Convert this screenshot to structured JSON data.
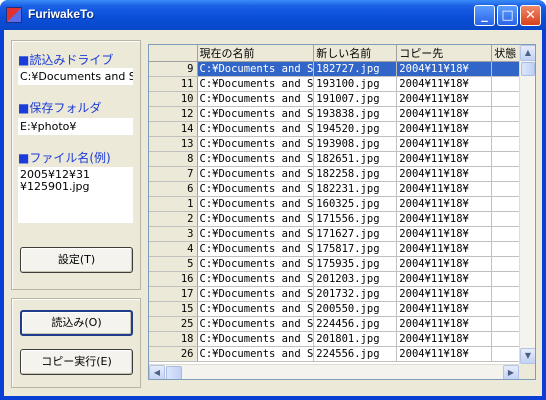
{
  "window": {
    "title": "FuriwakeTo"
  },
  "titlebar": {
    "min_glyph": "_",
    "max_glyph": "□",
    "close_glyph": "✕"
  },
  "panel": {
    "read_drive_label": "■読込みドライブ",
    "read_drive_value": "C:¥Documents and Se",
    "save_folder_label": "■保存フォルダ",
    "save_folder_value": "E:¥photo¥",
    "filename_label": "■ファイル名(例)",
    "filename_example_line1": "2005¥12¥31",
    "filename_example_line2": "¥125901.jpg",
    "settings_button": "設定(T)",
    "load_button": "読込み(O)",
    "copy_button": "コピー実行(E)"
  },
  "grid": {
    "columns": [
      "",
      "現在の名前",
      "新しい名前",
      "コピー先",
      "状態"
    ],
    "selected_row_index": 0,
    "rows": [
      [
        "9",
        "C:¥Documents and S",
        "182727.jpg",
        "2004¥11¥18¥",
        ""
      ],
      [
        "11",
        "C:¥Documents and S",
        "193100.jpg",
        "2004¥11¥18¥",
        ""
      ],
      [
        "10",
        "C:¥Documents and S",
        "191007.jpg",
        "2004¥11¥18¥",
        ""
      ],
      [
        "12",
        "C:¥Documents and S",
        "193838.jpg",
        "2004¥11¥18¥",
        ""
      ],
      [
        "14",
        "C:¥Documents and S",
        "194520.jpg",
        "2004¥11¥18¥",
        ""
      ],
      [
        "13",
        "C:¥Documents and S",
        "193908.jpg",
        "2004¥11¥18¥",
        ""
      ],
      [
        "8",
        "C:¥Documents and S",
        "182651.jpg",
        "2004¥11¥18¥",
        ""
      ],
      [
        "7",
        "C:¥Documents and S",
        "182258.jpg",
        "2004¥11¥18¥",
        ""
      ],
      [
        "6",
        "C:¥Documents and S",
        "182231.jpg",
        "2004¥11¥18¥",
        ""
      ],
      [
        "1",
        "C:¥Documents and S",
        "160325.jpg",
        "2004¥11¥18¥",
        ""
      ],
      [
        "2",
        "C:¥Documents and S",
        "171556.jpg",
        "2004¥11¥18¥",
        ""
      ],
      [
        "3",
        "C:¥Documents and S",
        "171627.jpg",
        "2004¥11¥18¥",
        ""
      ],
      [
        "4",
        "C:¥Documents and S",
        "175817.jpg",
        "2004¥11¥18¥",
        ""
      ],
      [
        "5",
        "C:¥Documents and S",
        "175935.jpg",
        "2004¥11¥18¥",
        ""
      ],
      [
        "16",
        "C:¥Documents and S",
        "201203.jpg",
        "2004¥11¥18¥",
        ""
      ],
      [
        "17",
        "C:¥Documents and S",
        "201732.jpg",
        "2004¥11¥18¥",
        ""
      ],
      [
        "15",
        "C:¥Documents and S",
        "200550.jpg",
        "2004¥11¥18¥",
        ""
      ],
      [
        "25",
        "C:¥Documents and S",
        "224456.jpg",
        "2004¥11¥18¥",
        ""
      ],
      [
        "18",
        "C:¥Documents and S",
        "201801.jpg",
        "2004¥11¥18¥",
        ""
      ],
      [
        "26",
        "C:¥Documents and S",
        "224556.jpg",
        "2004¥11¥18¥",
        ""
      ]
    ]
  },
  "scrollbars": {
    "up": "▲",
    "down": "▼",
    "left": "◀",
    "right": "▶"
  }
}
